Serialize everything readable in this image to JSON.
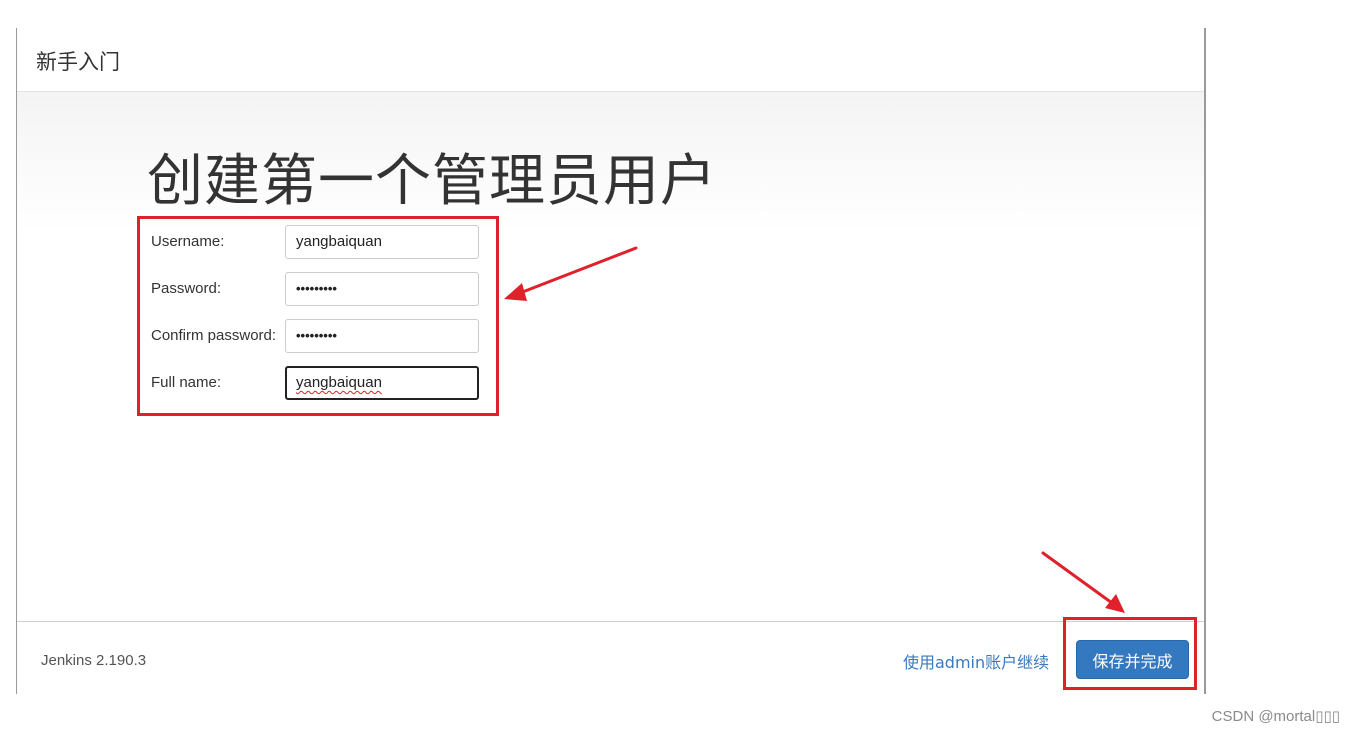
{
  "header": {
    "title": "新手入门"
  },
  "main": {
    "heading": "创建第一个管理员用户",
    "form": {
      "username": {
        "label": "Username:",
        "value": "yangbaiquan"
      },
      "password": {
        "label": "Password:",
        "value": "•••••••••"
      },
      "confirm_password": {
        "label": "Confirm password:",
        "value": "•••••••••"
      },
      "full_name": {
        "label": "Full name:",
        "value": "yangbaiquan"
      }
    }
  },
  "footer": {
    "version": "Jenkins 2.190.3",
    "continue_link": "使用admin账户继续",
    "save_button": "保存并完成"
  },
  "watermark": "CSDN @mortal▯▯▯",
  "colors": {
    "annotation": "#e0202a",
    "primary": "#3478bf",
    "link": "#3a7abf"
  }
}
